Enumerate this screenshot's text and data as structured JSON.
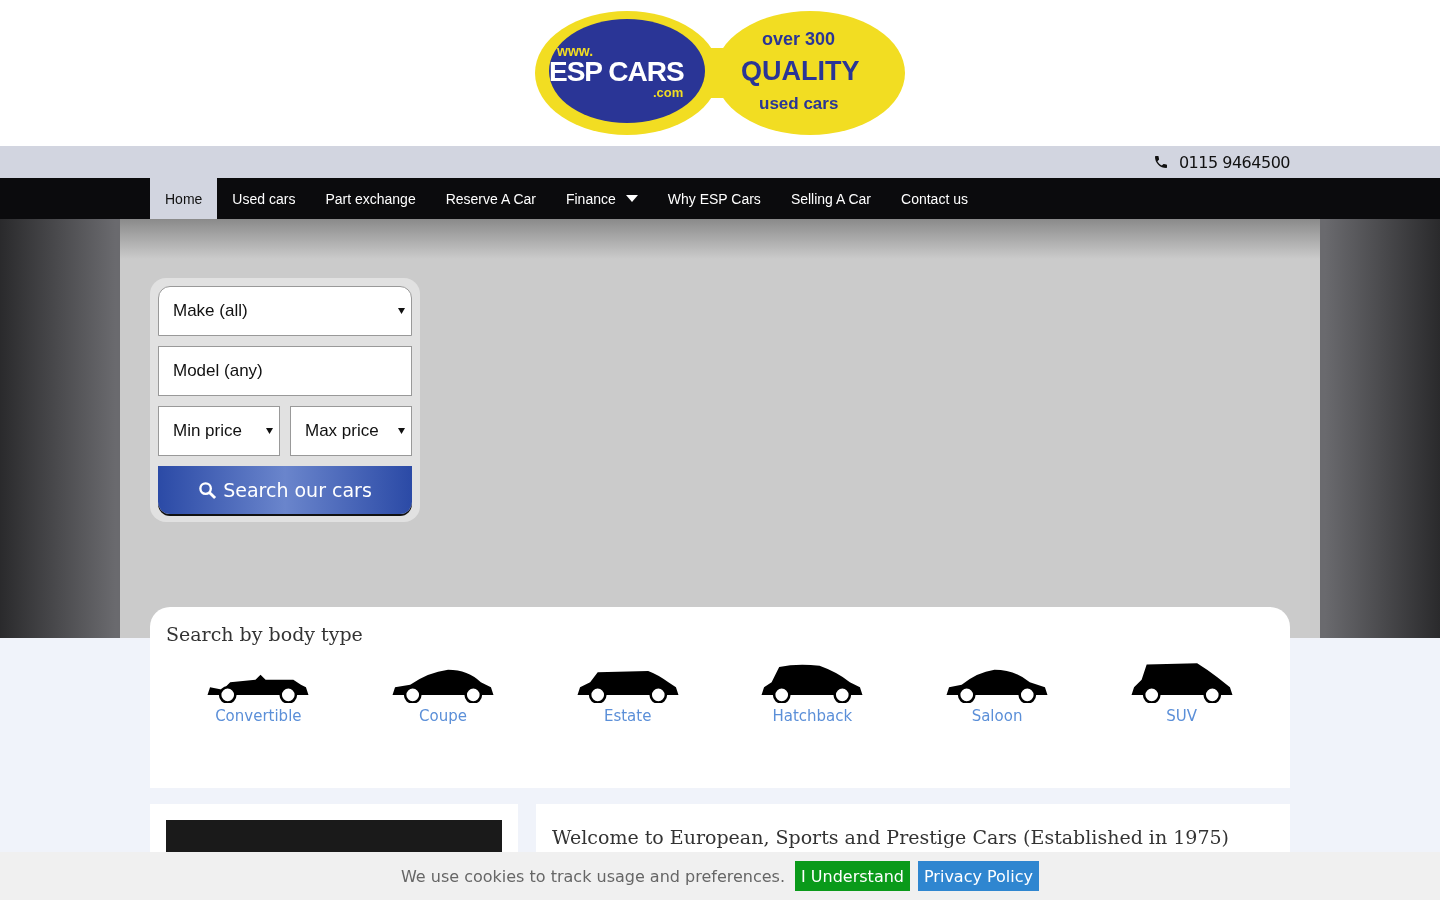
{
  "logo": {
    "www": "www.",
    "brand": "ESP CARS",
    "domain": ".com",
    "line_1": "over 300",
    "line_2": "QUALITY",
    "line_3": "used cars"
  },
  "phone": "0115 9464500",
  "nav": [
    {
      "label": "Home",
      "selected": true,
      "dropdown": false
    },
    {
      "label": "Used cars",
      "selected": false,
      "dropdown": false
    },
    {
      "label": "Part exchange",
      "selected": false,
      "dropdown": false
    },
    {
      "label": "Reserve A Car",
      "selected": false,
      "dropdown": false
    },
    {
      "label": "Finance",
      "selected": false,
      "dropdown": true
    },
    {
      "label": "Why ESP Cars",
      "selected": false,
      "dropdown": false
    },
    {
      "label": "Selling A Car",
      "selected": false,
      "dropdown": false
    },
    {
      "label": "Contact us",
      "selected": false,
      "dropdown": false
    }
  ],
  "search": {
    "make": "Make (all)",
    "model": "Model (any)",
    "min_price": "Min price",
    "max_price": "Max price",
    "button": "Search our cars"
  },
  "body_types": {
    "title": "Search by body type",
    "items": [
      {
        "label": "Convertible",
        "kind": "convertible"
      },
      {
        "label": "Coupe",
        "kind": "coupe"
      },
      {
        "label": "Estate",
        "kind": "estate"
      },
      {
        "label": "Hatchback",
        "kind": "hatchback"
      },
      {
        "label": "Saloon",
        "kind": "saloon"
      },
      {
        "label": "SUV",
        "kind": "suv"
      }
    ]
  },
  "welcome": {
    "title": "Welcome to European, Sports and Prestige Cars (Established in 1975)"
  },
  "cookie": {
    "text": "We use cookies to track usage and preferences.",
    "accept": "I Understand",
    "policy": "Privacy Policy"
  }
}
